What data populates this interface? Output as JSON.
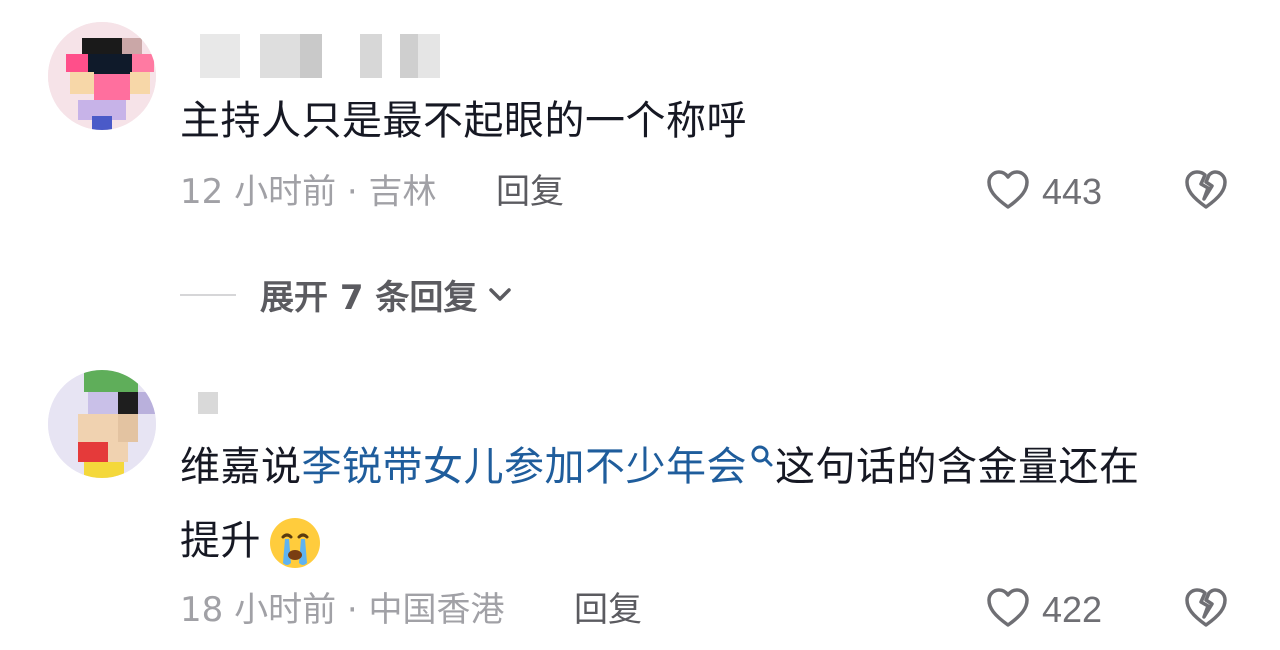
{
  "comments": [
    {
      "text": "主持人只是最不起眼的一个称呼",
      "time_location": "12 小时前 · 吉林",
      "reply_label": "回复",
      "likes": "443"
    },
    {
      "text_plain_1": "维嘉说",
      "text_link": "李锐带女儿参加不少年会",
      "text_plain_2": "这句话的含金量还在",
      "text_line2": "提升",
      "emoji": "crying-face-icon",
      "time_location": "18 小时前 · 中国香港",
      "reply_label": "回复",
      "likes": "422"
    }
  ],
  "expand_replies_label": "展开 7 条回复",
  "colors": {
    "text": "#161823",
    "meta": "#a1a1a6",
    "link": "#1f5d9c",
    "icon": "#6f6f74"
  }
}
